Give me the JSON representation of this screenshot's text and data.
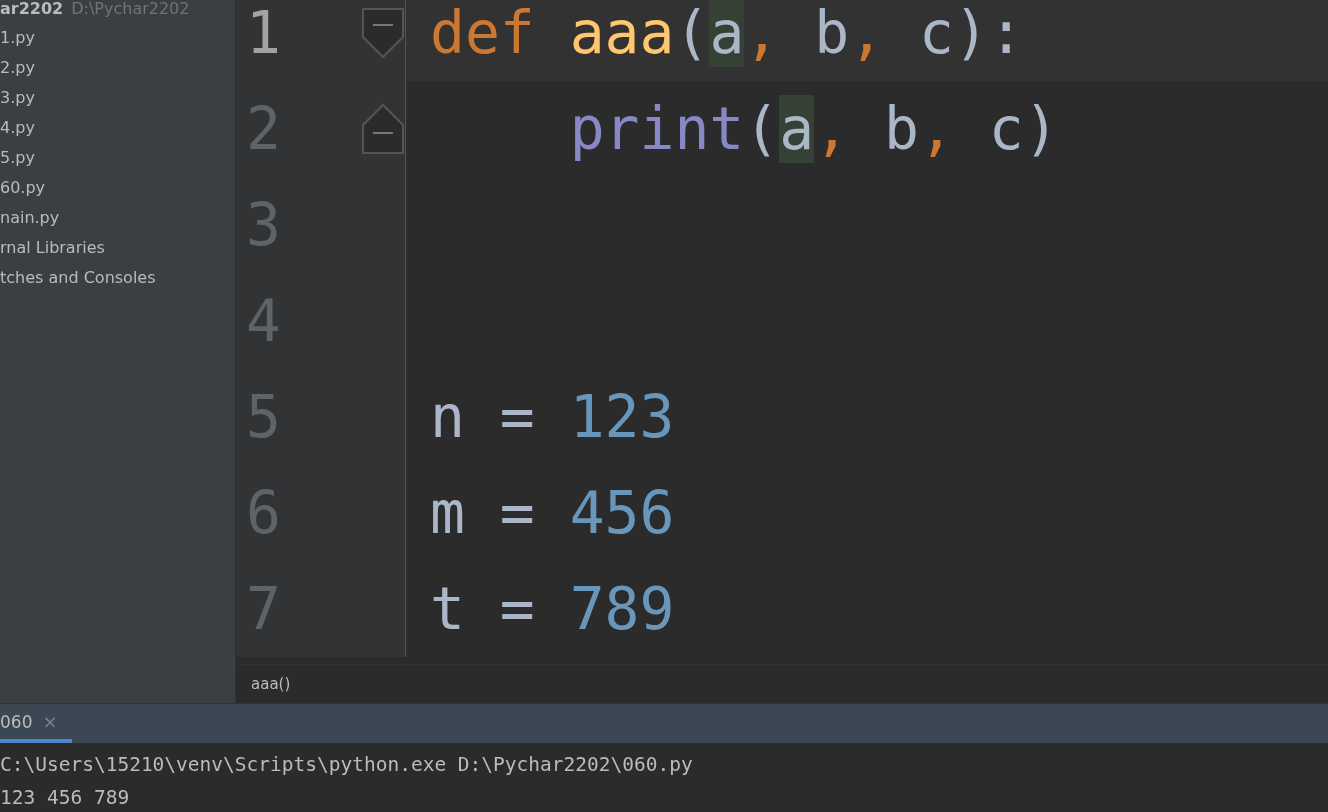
{
  "project": {
    "name": "ar2202",
    "path": "D:\\Pychar2202"
  },
  "sidebar": {
    "items": [
      {
        "label": "1.py"
      },
      {
        "label": "2.py"
      },
      {
        "label": "3.py"
      },
      {
        "label": "4.py"
      },
      {
        "label": "5.py"
      },
      {
        "label": "60.py"
      },
      {
        "label": "nain.py"
      },
      {
        "label": "rnal Libraries"
      },
      {
        "label": "tches and Consoles"
      }
    ]
  },
  "editor": {
    "lines": [
      {
        "number": "1",
        "selected": true,
        "indented": false,
        "fold_open": true,
        "tokens": [
          {
            "text": "def ",
            "kind": "keyword",
            "highlighted": false
          },
          {
            "text": "aaa",
            "kind": "function",
            "highlighted": false
          },
          {
            "text": "(",
            "kind": "plain",
            "highlighted": false
          },
          {
            "text": "a",
            "kind": "plain",
            "highlighted": true
          },
          {
            "text": ", ",
            "kind": "comma",
            "highlighted": false
          },
          {
            "text": "b",
            "kind": "plain",
            "highlighted": false
          },
          {
            "text": ", ",
            "kind": "comma",
            "highlighted": false
          },
          {
            "text": "c",
            "kind": "plain",
            "highlighted": false
          },
          {
            "text": "):",
            "kind": "plain",
            "highlighted": false
          }
        ]
      },
      {
        "number": "2",
        "selected": false,
        "indented": true,
        "fold_close": true,
        "tokens": [
          {
            "text": "print",
            "kind": "builtin",
            "highlighted": false
          },
          {
            "text": "(",
            "kind": "plain",
            "highlighted": false
          },
          {
            "text": "a",
            "kind": "plain",
            "highlighted": true
          },
          {
            "text": ", ",
            "kind": "comma",
            "highlighted": false
          },
          {
            "text": "b",
            "kind": "plain",
            "highlighted": false
          },
          {
            "text": ", ",
            "kind": "comma",
            "highlighted": false
          },
          {
            "text": "c",
            "kind": "plain",
            "highlighted": false
          },
          {
            "text": ")",
            "kind": "plain",
            "highlighted": false
          }
        ]
      },
      {
        "number": "3",
        "selected": false
      },
      {
        "number": "4",
        "selected": false
      },
      {
        "number": "5",
        "selected": false,
        "indented": false,
        "tokens": [
          {
            "text": "n = ",
            "kind": "plain",
            "highlighted": false
          },
          {
            "text": "123",
            "kind": "number",
            "highlighted": false
          }
        ]
      },
      {
        "number": "6",
        "selected": false,
        "indented": false,
        "tokens": [
          {
            "text": "m = ",
            "kind": "plain",
            "highlighted": false
          },
          {
            "text": "456",
            "kind": "number",
            "highlighted": false
          }
        ]
      },
      {
        "number": "7",
        "selected": false,
        "indented": false,
        "tokens": [
          {
            "text": "t = ",
            "kind": "plain",
            "highlighted": false
          },
          {
            "text": "789",
            "kind": "number",
            "highlighted": false
          }
        ]
      }
    ],
    "breadcrumb": "aaa()"
  },
  "run_panel": {
    "tabs": [
      {
        "label": "060",
        "close": "×",
        "selected": true
      }
    ],
    "output": [
      "C:\\Users\\15210\\venv\\Scripts\\python.exe D:\\Pychar2202\\060.py",
      "123 456 789"
    ]
  }
}
